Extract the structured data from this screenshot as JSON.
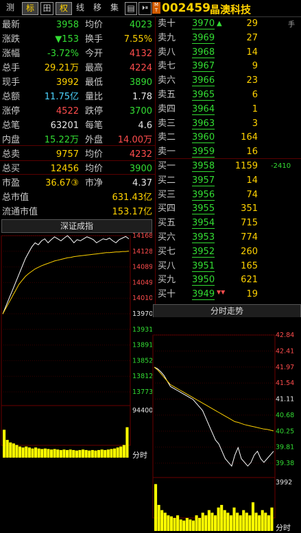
{
  "toolbar": {
    "tabs": [
      "测",
      "标",
      "田",
      "权",
      "线",
      "移",
      "集",
      "▤",
      "⏵⏸"
    ],
    "mt_badge": "M T",
    "code": "002459",
    "name": "晶澳科技"
  },
  "quote": {
    "rows": [
      {
        "l1": "最新",
        "v1": "3958",
        "c1": "green",
        "l2": "均价",
        "v2": "4023",
        "c2": "green"
      },
      {
        "l1": "涨跌",
        "v1": "▼153",
        "c1": "green",
        "l2": "换手",
        "v2": "7.55%",
        "c2": "yellow"
      },
      {
        "l1": "涨幅",
        "v1": "-3.72%",
        "c1": "green",
        "l2": "今开",
        "v2": "4132",
        "c2": "red"
      },
      {
        "l1": "总手",
        "v1": "29.21万",
        "c1": "yellow",
        "l2": "最高",
        "v2": "4224",
        "c2": "red"
      },
      {
        "l1": "现手",
        "v1": "3992",
        "c1": "yellow",
        "l2": "最低",
        "v2": "3890",
        "c2": "green"
      },
      {
        "l1": "总额",
        "v1": "11.75亿",
        "c1": "cyan",
        "l2": "量比",
        "v2": "1.78",
        "c2": "white"
      },
      {
        "l1": "涨停",
        "v1": "4522",
        "c1": "red",
        "l2": "跌停",
        "v2": "3700",
        "c2": "green"
      },
      {
        "l1": "总笔",
        "v1": "63201",
        "c1": "white",
        "l2": "每笔",
        "v2": "4.6",
        "c2": "white"
      },
      {
        "l1": "内盘",
        "v1": "15.22万",
        "c1": "green",
        "l2": "外盘",
        "v2": "14.00万",
        "c2": "red"
      },
      {
        "l1": "总卖",
        "v1": "9757",
        "c1": "yellow",
        "l2": "均价",
        "v2": "4232",
        "c2": "red"
      },
      {
        "l1": "总买",
        "v1": "12456",
        "c1": "yellow",
        "l2": "均价",
        "v2": "3900",
        "c2": "green"
      },
      {
        "l1": "市盈",
        "v1": "36.67③",
        "c1": "yellow",
        "l2": "市净",
        "v2": "4.37",
        "c2": "white"
      }
    ],
    "mkt_cap_label": "总市值",
    "mkt_cap_value": "631.43亿",
    "float_cap_label": "流通市值",
    "float_cap_value": "153.17亿"
  },
  "orderbook": {
    "sell": [
      {
        "label": "卖十",
        "price": "3970",
        "qty": "29"
      },
      {
        "label": "卖九",
        "price": "3969",
        "qty": "27"
      },
      {
        "label": "卖八",
        "price": "3968",
        "qty": "14"
      },
      {
        "label": "卖七",
        "price": "3967",
        "qty": "9"
      },
      {
        "label": "卖六",
        "price": "3966",
        "qty": "23"
      },
      {
        "label": "卖五",
        "price": "3965",
        "qty": "6"
      },
      {
        "label": "卖四",
        "price": "3964",
        "qty": "1"
      },
      {
        "label": "卖三",
        "price": "3963",
        "qty": "3"
      },
      {
        "label": "卖二",
        "price": "3960",
        "qty": "164"
      },
      {
        "label": "卖一",
        "price": "3959",
        "qty": "16"
      }
    ],
    "buy": [
      {
        "label": "买一",
        "price": "3958",
        "qty": "1159"
      },
      {
        "label": "买二",
        "price": "3957",
        "qty": "14"
      },
      {
        "label": "买三",
        "price": "3956",
        "qty": "74"
      },
      {
        "label": "买四",
        "price": "3955",
        "qty": "351"
      },
      {
        "label": "买五",
        "price": "3954",
        "qty": "715"
      },
      {
        "label": "买六",
        "price": "3953",
        "qty": "774"
      },
      {
        "label": "买七",
        "price": "3952",
        "qty": "260"
      },
      {
        "label": "买八",
        "price": "3951",
        "qty": "165"
      },
      {
        "label": "买九",
        "price": "3950",
        "qty": "621"
      },
      {
        "label": "买十",
        "price": "3949",
        "qty": "19"
      }
    ],
    "side_label": "手",
    "side_change": "-2410",
    "up_arrow": "▲",
    "down_arrow": "▼▼"
  },
  "index_chart": {
    "title": "深证成指",
    "y_labels": [
      "14168",
      "14128",
      "14089",
      "14049",
      "14010",
      "13970",
      "13931",
      "13891",
      "13852",
      "13812",
      "13773"
    ],
    "y_colors": [
      "red",
      "red",
      "red",
      "red",
      "red",
      "white",
      "green",
      "green",
      "green",
      "green",
      "green"
    ],
    "vol_label": "94400",
    "x_label": "分时",
    "price": [
      13970,
      13990,
      14010,
      14030,
      14050,
      14070,
      14090,
      14110,
      14125,
      14140,
      14150,
      14145,
      14155,
      14160,
      14150,
      14158,
      14165,
      14160,
      14155,
      14162,
      14168,
      14160,
      14150,
      14158,
      14155,
      14160,
      14165,
      14162,
      14158,
      14150,
      14155,
      14160,
      14158,
      14162,
      14155,
      14150,
      14158,
      14162,
      14166,
      14160
    ],
    "avg": [
      13970,
      13985,
      14000,
      14015,
      14030,
      14045,
      14055,
      14065,
      14072,
      14078,
      14084,
      14088,
      14092,
      14095,
      14098,
      14101,
      14104,
      14106,
      14108,
      14110,
      14112,
      14113,
      14115,
      14116,
      14117,
      14118,
      14119,
      14120,
      14121,
      14122,
      14123,
      14124,
      14125,
      14125,
      14126,
      14127,
      14127,
      14128,
      14128,
      14129
    ],
    "volume": [
      0.55,
      0.35,
      0.3,
      0.28,
      0.25,
      0.22,
      0.2,
      0.22,
      0.2,
      0.18,
      0.2,
      0.18,
      0.17,
      0.18,
      0.17,
      0.16,
      0.17,
      0.16,
      0.15,
      0.16,
      0.15,
      0.16,
      0.15,
      0.14,
      0.15,
      0.16,
      0.15,
      0.14,
      0.15,
      0.14,
      0.15,
      0.16,
      0.15,
      0.16,
      0.17,
      0.18,
      0.2,
      0.22,
      0.25,
      0.6
    ]
  },
  "tick_chart": {
    "title": "分时走势",
    "y_labels": [
      "42.84",
      "42.41",
      "41.97",
      "41.54",
      "41.11",
      "40.68",
      "40.25",
      "39.81",
      "39.38"
    ],
    "y_colors": [
      "red",
      "red",
      "red",
      "red",
      "white",
      "green",
      "green",
      "green",
      "green"
    ],
    "vol_label": "3992",
    "x_label": "分时",
    "price": [
      41.97,
      41.93,
      41.85,
      41.75,
      41.6,
      41.45,
      41.4,
      41.35,
      41.3,
      41.25,
      41.2,
      41.15,
      41.1,
      41.0,
      40.9,
      40.8,
      40.6,
      40.4,
      40.2,
      40.0,
      39.9,
      39.7,
      39.5,
      39.4,
      39.3,
      39.6,
      39.8,
      39.5,
      39.4,
      39.3,
      39.4,
      39.6,
      39.7,
      39.5,
      39.4,
      39.5,
      39.6,
      39.7
    ],
    "avg": [
      41.97,
      41.9,
      41.8,
      41.7,
      41.6,
      41.5,
      41.45,
      41.4,
      41.35,
      41.3,
      41.25,
      41.2,
      41.15,
      41.1,
      41.05,
      41.0,
      40.95,
      40.9,
      40.85,
      40.8,
      40.75,
      40.7,
      40.65,
      40.6,
      40.55,
      40.5,
      40.48,
      40.45,
      40.42,
      40.4,
      40.38,
      40.36,
      40.34,
      40.32,
      40.3,
      40.29,
      40.27,
      40.25
    ],
    "volume": [
      0.9,
      0.5,
      0.4,
      0.35,
      0.3,
      0.28,
      0.25,
      0.3,
      0.22,
      0.2,
      0.25,
      0.22,
      0.2,
      0.3,
      0.25,
      0.35,
      0.3,
      0.4,
      0.35,
      0.3,
      0.45,
      0.5,
      0.4,
      0.35,
      0.3,
      0.45,
      0.35,
      0.3,
      0.4,
      0.35,
      0.3,
      0.55,
      0.35,
      0.3,
      0.4,
      0.35,
      0.3,
      0.45
    ]
  }
}
